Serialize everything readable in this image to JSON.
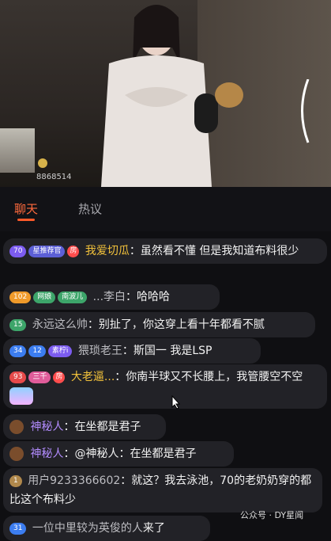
{
  "video": {
    "room_id_text": "8868514"
  },
  "tabs": [
    {
      "label": "聊天"
    },
    {
      "label": "热议"
    }
  ],
  "messages": [
    {
      "badges": [
        "70",
        "星推荐官",
        "房"
      ],
      "name": "我爱切瓜",
      "text": "：虽然看不懂 但是我知道布料很少"
    },
    {
      "badges": [
        "102",
        "网娘",
        "南波儿"
      ],
      "name": "...李白",
      "text": "：哈哈哈"
    },
    {
      "badges": [
        "15"
      ],
      "name": "永远这么帅",
      "text": "：别扯了，你这穿上看十年都看不腻"
    },
    {
      "badges": [
        "34",
        "12",
        "素柠i"
      ],
      "name": "猥琐老王",
      "text": "：斯国一 我是LSP"
    },
    {
      "badges": [
        "93",
        "三千",
        "房"
      ],
      "name": "大老逼...",
      "text": "：你南半球又不长腰上，我管腰空不空"
    },
    {
      "badges": [],
      "name": "神秘人",
      "text": "：在坐都是君子"
    },
    {
      "badges": [],
      "name": "神秘人",
      "text": "：@神秘人：在坐都是君子"
    },
    {
      "badges": [
        "1"
      ],
      "name": "用户9233366602",
      "text": "：就这？我去泳池，70的老奶奶穿的都比这个布料少"
    },
    {
      "badges": [
        "31"
      ],
      "name": "一位中里较为英俊的人",
      "text": "来了"
    }
  ],
  "watermark": "公众号 · DY星闻",
  "colors": {
    "accent": "#ff5a2a",
    "background": "#0f0f12",
    "bubble": "#222227"
  }
}
